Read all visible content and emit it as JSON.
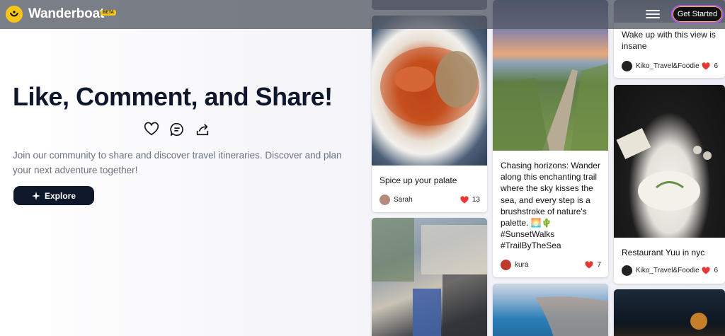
{
  "header": {
    "brand": "Wanderboat",
    "beta": "BETA",
    "cta_label": "Get Started"
  },
  "hero": {
    "title": "Like, Comment, and Share!",
    "description": "Join our community to share and discover travel itineraries. Discover and plan your next adventure together!",
    "explore_label": "Explore",
    "icons": [
      "heart-icon",
      "comment-icon",
      "share-icon"
    ]
  },
  "cards": [
    {
      "caption": "Spice up your palate",
      "user": "Sarah",
      "likes": "13"
    },
    {
      "caption": "Chasing horizons: Wander along this enchanting trail where the sky kisses the sea, and every step is a brushstroke of nature's palette. 🌅🌵 #SunsetWalks #TrailByTheSea",
      "user": "kura",
      "likes": "7"
    },
    {
      "caption": "Wake up with this view is insane",
      "user": "Kiko_Travel&Foodie",
      "likes": "6"
    },
    {
      "caption": "Restaurant Yuu in nyc",
      "user": "Kiko_Travel&Foodie",
      "likes": "6"
    }
  ],
  "colors": {
    "accent": "#f5c518",
    "dark": "#0f172a",
    "heart": "#e53935"
  }
}
